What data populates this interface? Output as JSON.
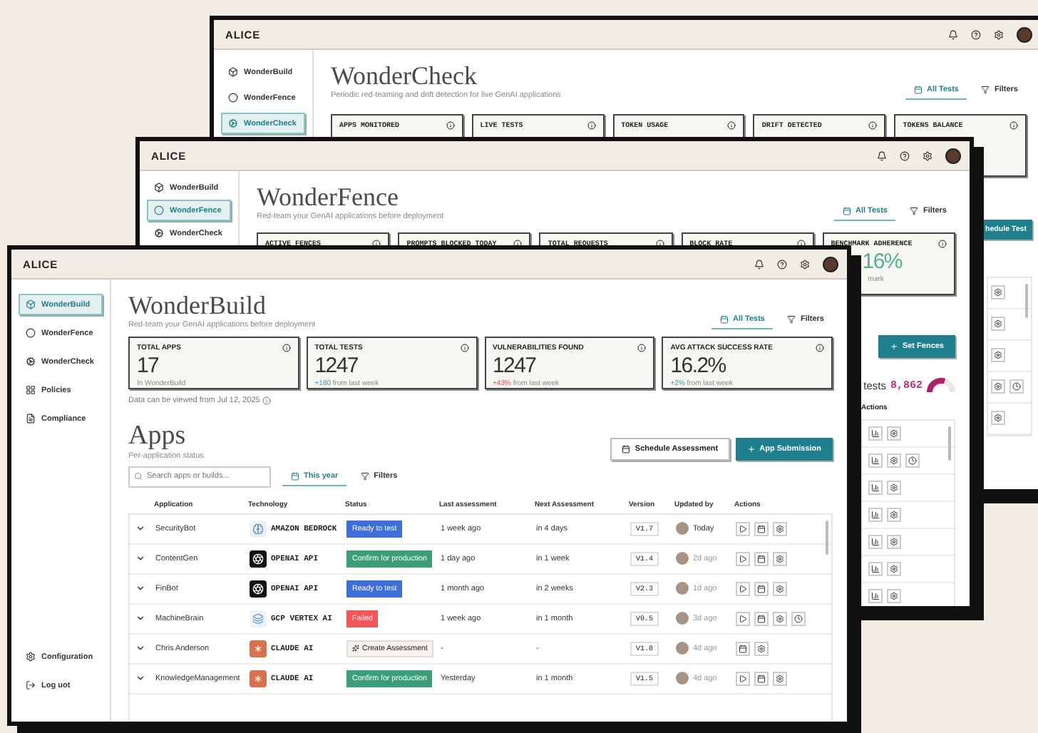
{
  "back_window": {
    "logo": "ALICE",
    "nav": [
      {
        "label": "WonderBuild",
        "selected": false
      },
      {
        "label": "WonderFence",
        "selected": false
      },
      {
        "label": "WonderCheck",
        "selected": true
      }
    ],
    "title": "WonderCheck",
    "subtitle": "Periodic red-teaming and drift detection for live GenAI applications",
    "tabs": [
      {
        "label": "All Tests",
        "selected": true
      },
      {
        "label": "Filters",
        "selected": false
      }
    ],
    "cards": [
      {
        "label": "APPS MONITORED"
      },
      {
        "label": "LIVE TESTS"
      },
      {
        "label": "TOKEN USAGE"
      },
      {
        "label": "DRIFT DETECTED"
      },
      {
        "label": "TOKENS BALANCE"
      }
    ],
    "button": "hedule Test",
    "rows": [
      {
        "history": false
      },
      {
        "history": false
      },
      {
        "history": false
      },
      {
        "history": true
      },
      {
        "history": false
      }
    ]
  },
  "middle_window": {
    "logo": "ALICE",
    "nav": [
      {
        "label": "WonderBuild",
        "selected": false
      },
      {
        "label": "WonderFence",
        "selected": true
      },
      {
        "label": "WonderCheck",
        "selected": false
      }
    ],
    "title": "WonderFence",
    "subtitle": "Red-team your GenAI applications before deployment",
    "tabs": [
      {
        "label": "All Tests",
        "selected": true
      },
      {
        "label": "Filters",
        "selected": false
      }
    ],
    "cards": [
      {
        "label": "ACTIVE FENCES"
      },
      {
        "label": "PROMPTS BLOCKED TODAY"
      },
      {
        "label": "TOTAL REQUESTS"
      },
      {
        "label": "BLOCK RATE"
      },
      {
        "label": "BENCHMARK ADHERENCE",
        "value": "16%",
        "note": "mark"
      }
    ],
    "button": "Set Fences",
    "summary": {
      "label": "tests",
      "value": "8,862",
      "level": 0.6
    },
    "actions_header": "Actions",
    "rows": [
      {
        "history": false
      },
      {
        "history": true
      },
      {
        "history": false
      },
      {
        "history": false
      },
      {
        "history": false
      },
      {
        "history": false
      },
      {
        "history": false
      }
    ]
  },
  "front_window": {
    "logo": "ALICE",
    "nav": [
      {
        "label": "WonderBuild",
        "selected": true
      },
      {
        "label": "WonderFence",
        "selected": false
      },
      {
        "label": "WonderCheck",
        "selected": false
      },
      {
        "label": "Policies",
        "selected": false
      },
      {
        "label": "Compliance",
        "selected": false
      }
    ],
    "nav_bottom": [
      {
        "label": "Configuration",
        "selected": false
      },
      {
        "label": "Log uot",
        "selected": false
      }
    ],
    "title": "WonderBuild",
    "subtitle": "Red-team your GenAI applications before deployment",
    "tabs": [
      {
        "label": "All Tests",
        "selected": true
      },
      {
        "label": "Filters",
        "selected": false
      }
    ],
    "cards": [
      {
        "label": "TOTAL APPS",
        "value": "17",
        "note": "In WonderBuild"
      },
      {
        "label": "TOTAL TESTS",
        "value": "1247",
        "delta": "+180",
        "kind": "positive",
        "note": "from last week"
      },
      {
        "label": "VULNERABILITIES FOUND",
        "value": "1247",
        "delta": "+43%",
        "kind": "negative",
        "note": "from last week"
      },
      {
        "label": "AVG ATTACK SUCCESS RATE",
        "value": "16.2%",
        "delta": "+2%",
        "kind": "positive",
        "note": "from last week"
      }
    ],
    "data_note": "Data can be viewed from Jul 12, 2025",
    "section": {
      "title": "Apps",
      "subtitle": "Per-application status"
    },
    "buttons": [
      {
        "label": "Schedule Assessment",
        "kind": "secondary"
      },
      {
        "label": "App Submission",
        "kind": "primary"
      }
    ],
    "search": {
      "placeholder": "Search apps or builds..."
    },
    "filter_tabs": [
      {
        "label": "This year",
        "selected": true
      },
      {
        "label": "Filters",
        "selected": false
      }
    ],
    "columns": [
      "Application",
      "Technology",
      "Status",
      "Last assessment",
      "Next Assessment",
      "Version",
      "Updated by",
      "Actions"
    ],
    "rows": [
      {
        "name": "SecurityBot",
        "tech": {
          "kind": "bedrock",
          "label": "AMAZON BEDROCK"
        },
        "status": {
          "kind": "ready",
          "label": "Ready to test"
        },
        "last": "1 week ago",
        "next": "in 4 days",
        "version": "V1.7",
        "updated": "Today",
        "runnable": true,
        "history": false
      },
      {
        "name": "ContentGen",
        "tech": {
          "kind": "openai",
          "label": "OPENAI API"
        },
        "status": {
          "kind": "confirm",
          "label": "Confirm for production"
        },
        "last": "1 day ago",
        "next": "in 1 week",
        "version": "V1.4",
        "updated": "2d ago",
        "runnable": true,
        "history": false
      },
      {
        "name": "FinBot",
        "tech": {
          "kind": "openai",
          "label": "OPENAI API"
        },
        "status": {
          "kind": "ready",
          "label": "Ready to test"
        },
        "last": "1 month ago",
        "next": "in 2 weeks",
        "version": "V2.3",
        "updated": "1d ago",
        "runnable": true,
        "history": false
      },
      {
        "name": "MachineBrain",
        "tech": {
          "kind": "vertex",
          "label": "GCP VERTEX AI"
        },
        "status": {
          "kind": "failed",
          "label": "Failed"
        },
        "last": "1 week ago",
        "next": "in 1 month",
        "version": "V0.5",
        "updated": "3d ago",
        "runnable": true,
        "history": true
      },
      {
        "name": "Chris Anderson",
        "tech": {
          "kind": "claude",
          "label": "CLAUDE AI"
        },
        "status": {
          "kind": "create",
          "label": "Create Assessment"
        },
        "last": "-",
        "next": "-",
        "version": "V1.0",
        "updated": "4d ago",
        "runnable": false,
        "history": false
      },
      {
        "name": "KnowledgeManagement",
        "tech": {
          "kind": "claude",
          "label": "CLAUDE AI"
        },
        "status": {
          "kind": "confirm",
          "label": "Confirm for production"
        },
        "last": "Yesterday",
        "next": "in 1 month",
        "version": "V1.5",
        "updated": "4d ago",
        "runnable": true,
        "history": false
      }
    ]
  }
}
